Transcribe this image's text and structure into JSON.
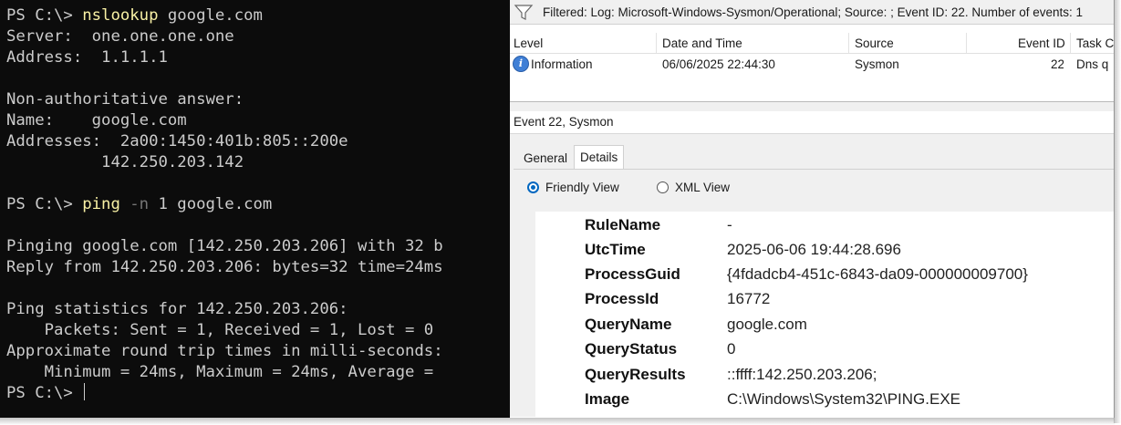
{
  "terminal": {
    "lines": [
      {
        "prompt": "PS C:\\> ",
        "cmd": "nslookup",
        "param": "",
        "rest": " google.com"
      },
      {
        "text": "Server:  one.one.one.one"
      },
      {
        "text": "Address:  1.1.1.1"
      },
      {
        "text": ""
      },
      {
        "text": "Non-authoritative answer:"
      },
      {
        "text": "Name:    google.com"
      },
      {
        "text": "Addresses:  2a00:1450:401b:805::200e"
      },
      {
        "text": "          142.250.203.142"
      },
      {
        "text": ""
      },
      {
        "prompt": "PS C:\\> ",
        "cmd": "ping",
        "param": " -n",
        "rest": " 1 google.com"
      },
      {
        "text": ""
      },
      {
        "text": "Pinging google.com [142.250.203.206] with 32 b"
      },
      {
        "text": "Reply from 142.250.203.206: bytes=32 time=24ms"
      },
      {
        "text": ""
      },
      {
        "text": "Ping statistics for 142.250.203.206:"
      },
      {
        "text": "    Packets: Sent = 1, Received = 1, Lost = 0"
      },
      {
        "text": "Approximate round trip times in milli-seconds:"
      },
      {
        "text": "    Minimum = 24ms, Maximum = 24ms, Average ="
      },
      {
        "prompt": "PS C:\\> ",
        "cmd": "",
        "param": "",
        "rest": ""
      }
    ]
  },
  "viewer": {
    "filter_text": "Filtered: Log: Microsoft-Windows-Sysmon/Operational; Source: ; Event ID: 22. Number of events: 1",
    "columns": {
      "level": "Level",
      "datetime": "Date and Time",
      "source": "Source",
      "event_id": "Event ID",
      "task": "Task C"
    },
    "row": {
      "level": "Information",
      "datetime": "06/06/2025 22:44:30",
      "source": "Sysmon",
      "event_id": "22",
      "task": "Dns q"
    },
    "pane_title": "Event 22, Sysmon",
    "tabs": {
      "general": "General",
      "details": "Details"
    },
    "views": {
      "friendly": "Friendly View",
      "xml": "XML View"
    },
    "fields": [
      {
        "key": "RuleName",
        "value": "-"
      },
      {
        "key": "UtcTime",
        "value": "2025-06-06 19:44:28.696"
      },
      {
        "key": "ProcessGuid",
        "value": "{4fdadcb4-451c-6843-da09-000000009700}"
      },
      {
        "key": "ProcessId",
        "value": "16772"
      },
      {
        "key": "QueryName",
        "value": "google.com"
      },
      {
        "key": "QueryStatus",
        "value": "0"
      },
      {
        "key": "QueryResults",
        "value": "::ffff:142.250.203.206;"
      },
      {
        "key": "Image",
        "value": "C:\\Windows\\System32\\PING.EXE"
      }
    ],
    "accent_color": "#0067c0",
    "info_icon": "info-icon"
  }
}
